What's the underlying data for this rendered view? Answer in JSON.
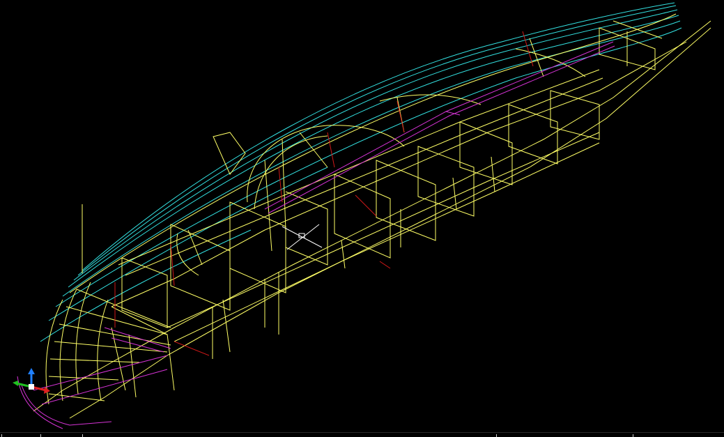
{
  "app": {
    "view": "3D Wireframe",
    "background_color": "#000000"
  },
  "layer_colors": {
    "hull_frames": "#ffff66",
    "sheer_lines": "#33e0e0",
    "keel_and_chines": "#d633d6",
    "centerline": "#d01818",
    "crosshair": "#ffffff"
  },
  "ucs_icon": {
    "icon": "ucs-axis-icon",
    "x_axis_color": "#e02020",
    "y_axis_color": "#20c020",
    "z_axis_color": "#2080ff"
  },
  "crosshair_cursor": {
    "icon": "crosshair-cursor-icon"
  }
}
